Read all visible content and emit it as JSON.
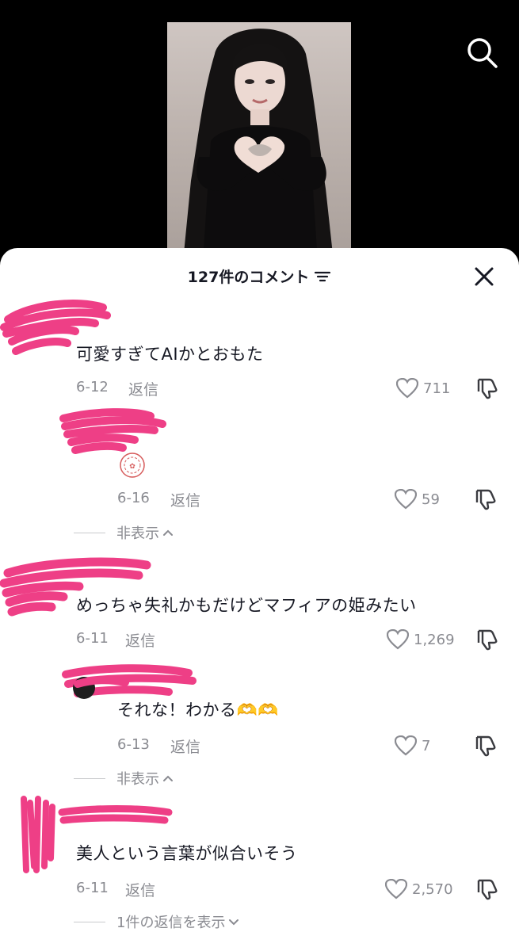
{
  "header": {
    "comment_count": "127件のコメント",
    "filter_icon": "filter-lines-icon",
    "close_icon": "close-icon",
    "search_icon": "search-icon"
  },
  "colors": {
    "scribble": "#ee3f86",
    "meta_text": "#8a8b91",
    "primary_text": "#161823"
  },
  "comments": [
    {
      "text": "可愛すぎてAIかとおもた",
      "date": "6-12",
      "reply": "返信",
      "likes": "711"
    },
    {
      "text": "",
      "sticker": "sakura-stamp-icon",
      "date": "6-16",
      "reply": "返信",
      "likes": "59"
    },
    {
      "text": "めっちゃ失礼かもだけどマフィアの姫みたい",
      "date": "6-11",
      "reply": "返信",
      "likes": "1,269"
    },
    {
      "text": "それな！わかる🫶🫶",
      "date": "6-13",
      "reply": "返信",
      "likes": "7"
    },
    {
      "text": "美人という言葉が似合いそう",
      "date": "6-11",
      "reply": "返信",
      "likes": "2,570"
    }
  ],
  "toggles": {
    "hide_1": "非表示",
    "hide_2": "非表示",
    "show_replies": "1件の返信を表示"
  }
}
